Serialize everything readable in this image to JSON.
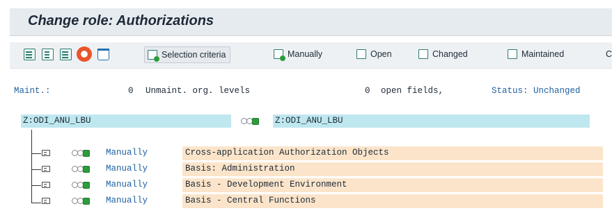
{
  "header": {
    "title": "Change role: Authorizations"
  },
  "toolbar": {
    "icons": [
      "table-icon",
      "document-icon",
      "transport-icon",
      "help-lifebuoy-icon",
      "trash-icon"
    ],
    "buttons": [
      {
        "label": "Selection criteria",
        "icon": "selection-criteria-icon"
      },
      {
        "label": "Manually",
        "icon": "manually-icon"
      },
      {
        "label": "Open",
        "icon": "open-icon"
      },
      {
        "label": "Changed",
        "icon": "changed-icon"
      },
      {
        "label": "Maintained",
        "icon": "maintained-icon"
      },
      {
        "label": "C"
      }
    ]
  },
  "status_bar": {
    "maint_label": "Maint.:",
    "unmaint_count": "0",
    "unmaint_label": "Unmaint. org. levels",
    "open_count": "0",
    "open_label": "open fields,",
    "status_text": "Status: Unchanged"
  },
  "role": {
    "name": "Z:ODI_ANU_LBU",
    "name_right": "Z:ODI_ANU_LBU"
  },
  "tree": {
    "items": [
      {
        "mode": "Manually",
        "description": "Cross-application Authorization Objects"
      },
      {
        "mode": "Manually",
        "description": "Basis: Administration"
      },
      {
        "mode": "Manually",
        "description": "Basis - Development Environment"
      },
      {
        "mode": "Manually",
        "description": "Basis - Central Functions"
      }
    ]
  },
  "colors": {
    "link": "#1f5fa0",
    "role_highlight": "#bfe7ef",
    "row_highlight": "#fbe4ca",
    "status_green": "#2d9c3c"
  }
}
